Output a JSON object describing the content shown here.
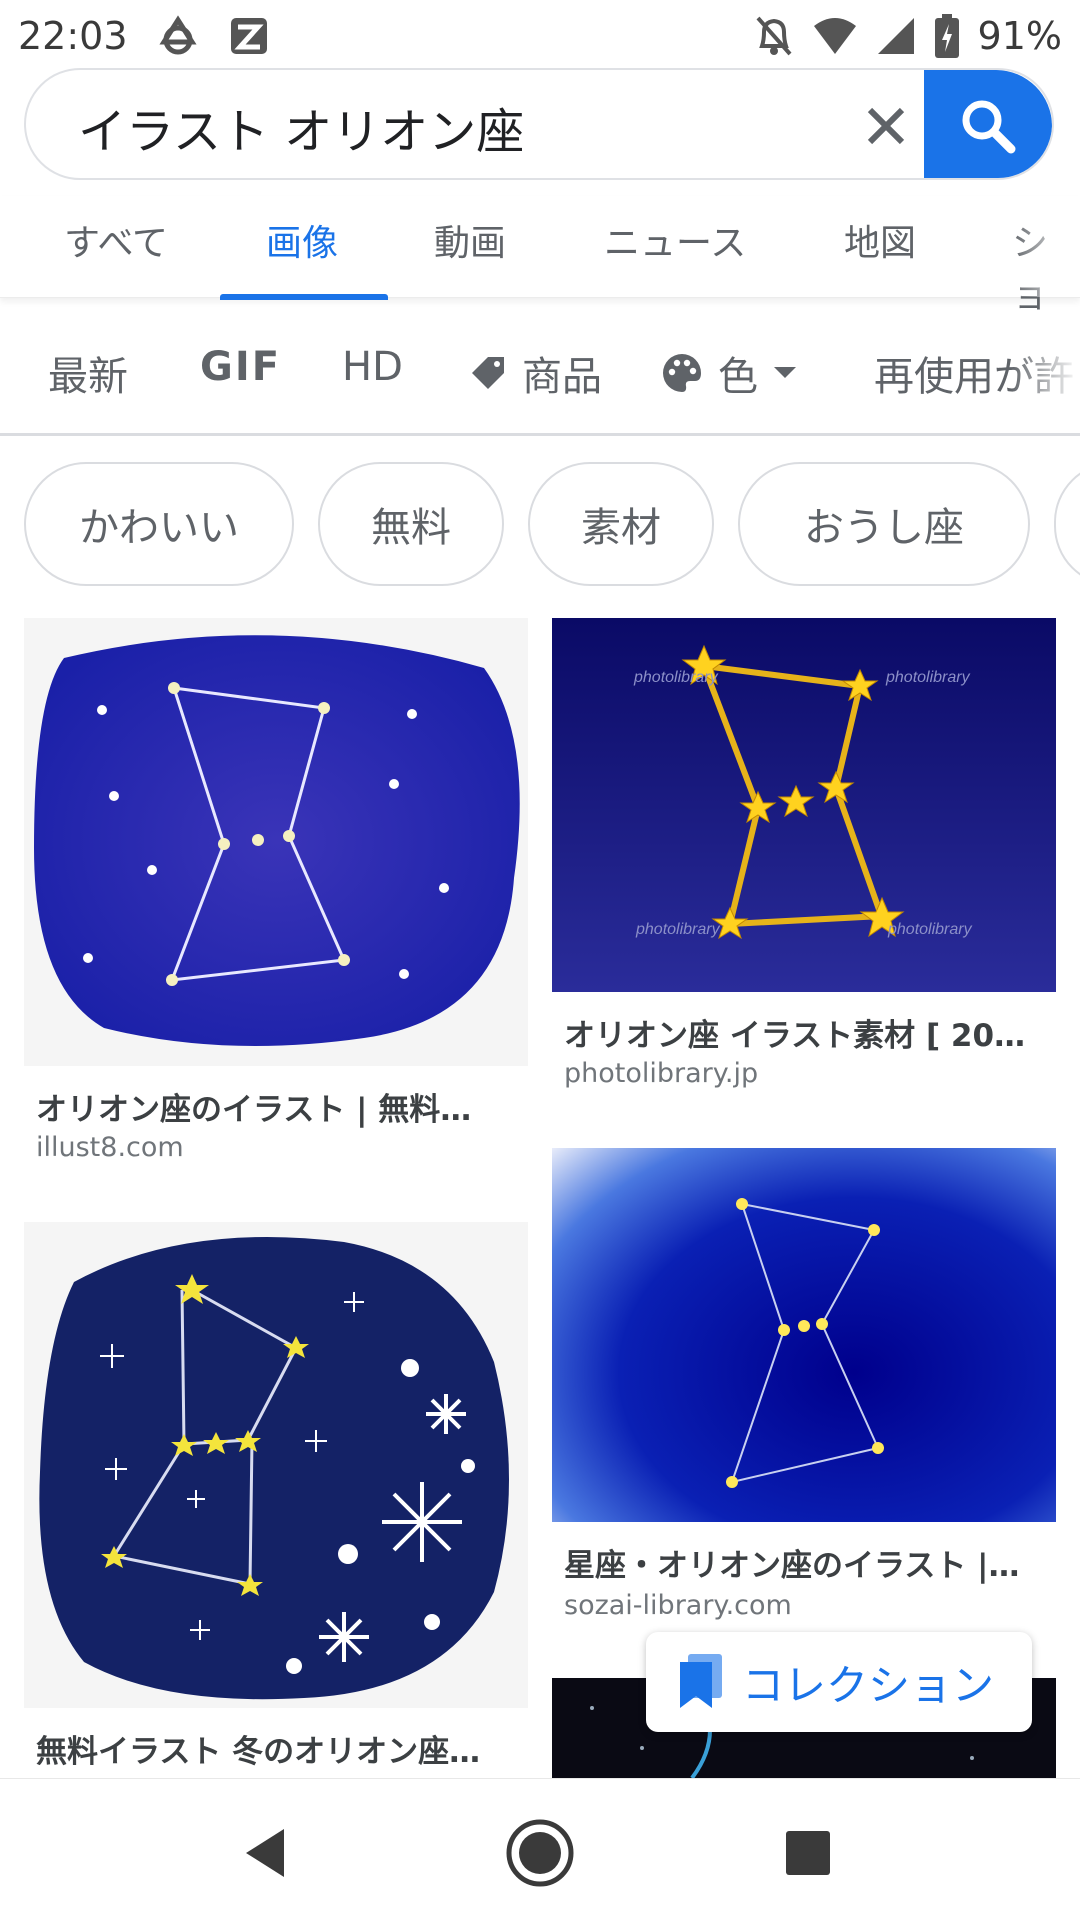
{
  "status_bar": {
    "time": "22:03",
    "battery": "91%"
  },
  "search": {
    "query": "イラスト オリオン座"
  },
  "tabs": [
    {
      "label": "すべて"
    },
    {
      "label": "画像"
    },
    {
      "label": "動画"
    },
    {
      "label": "ニュース"
    },
    {
      "label": "地図"
    },
    {
      "label": "ショ"
    }
  ],
  "filters": {
    "recent": "最新",
    "gif": "GIF",
    "hd": "HD",
    "products": "商品",
    "color": "色",
    "usage": "再使用が許"
  },
  "chips": [
    {
      "label": "かわいい"
    },
    {
      "label": "無料"
    },
    {
      "label": "素材"
    },
    {
      "label": "おうし座"
    }
  ],
  "results": [
    {
      "title": "オリオン座のイラスト | 無料…",
      "source": "illust8.com"
    },
    {
      "title": "オリオン座 イラスト素材 [ 20…",
      "source": "photolibrary.jp",
      "watermark": "photolibrary"
    },
    {
      "title": "無料イラスト 冬のオリオン座…",
      "source": ""
    },
    {
      "title": "星座・オリオン座のイラスト |…",
      "source": "sozai-library.com"
    }
  ],
  "collection": {
    "label": "コレクション"
  },
  "colors": {
    "accent": "#1a73e8",
    "star": "#ffd21f",
    "navy": "#1b2a8c"
  }
}
